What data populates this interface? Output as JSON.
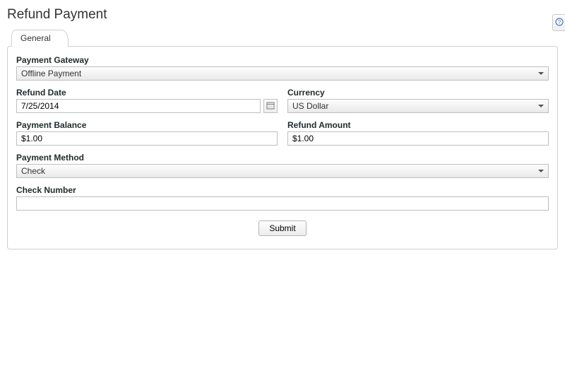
{
  "header": {
    "title": "Refund Payment"
  },
  "tabs": [
    {
      "label": "General",
      "active": true
    }
  ],
  "form": {
    "payment_gateway": {
      "label": "Payment Gateway",
      "value": "Offline Payment"
    },
    "refund_date": {
      "label": "Refund Date",
      "value": "7/25/2014"
    },
    "currency": {
      "label": "Currency",
      "value": "US Dollar"
    },
    "payment_balance": {
      "label": "Payment Balance",
      "value": "$1.00"
    },
    "refund_amount": {
      "label": "Refund Amount",
      "value": "$1.00"
    },
    "payment_method": {
      "label": "Payment Method",
      "value": "Check"
    },
    "check_number": {
      "label": "Check Number",
      "value": ""
    }
  },
  "actions": {
    "submit": "Submit"
  },
  "icons": {
    "help": "help-icon",
    "calendar": "calendar-icon",
    "dropdown": "chevron-down-icon"
  }
}
